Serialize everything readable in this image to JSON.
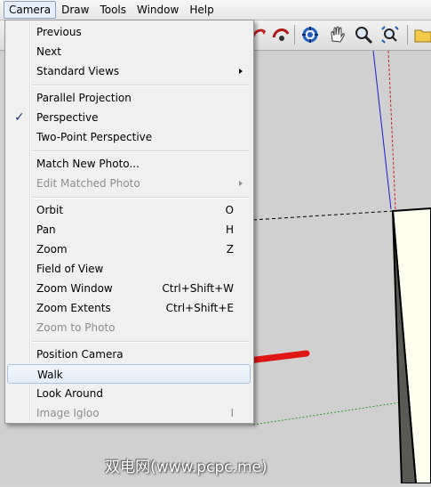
{
  "menubar": {
    "items": [
      {
        "label": "Camera"
      },
      {
        "label": "Draw"
      },
      {
        "label": "Tools"
      },
      {
        "label": "Window"
      },
      {
        "label": "Help"
      }
    ]
  },
  "toolbar": {
    "tools": [
      "tape-icon",
      "look-around-icon",
      "orbit-icon",
      "pan-icon",
      "zoom-icon",
      "zoom-extents-icon",
      "folder-icon"
    ]
  },
  "camera_menu": {
    "items": [
      {
        "label": "Previous",
        "shortcut": "",
        "enabled": true
      },
      {
        "label": "Next",
        "shortcut": "",
        "enabled": true
      },
      {
        "label": "Standard Views",
        "shortcut": "",
        "enabled": true,
        "submenu": true
      },
      {
        "label": "Parallel Projection",
        "shortcut": "",
        "enabled": true
      },
      {
        "label": "Perspective",
        "shortcut": "",
        "enabled": true,
        "checked": true
      },
      {
        "label": "Two-Point Perspective",
        "shortcut": "",
        "enabled": true
      },
      {
        "label": "Match New Photo...",
        "shortcut": "",
        "enabled": true
      },
      {
        "label": "Edit Matched Photo",
        "shortcut": "",
        "enabled": false,
        "submenu": true
      },
      {
        "label": "Orbit",
        "shortcut": "O",
        "enabled": true
      },
      {
        "label": "Pan",
        "shortcut": "H",
        "enabled": true
      },
      {
        "label": "Zoom",
        "shortcut": "Z",
        "enabled": true
      },
      {
        "label": "Field of View",
        "shortcut": "",
        "enabled": true
      },
      {
        "label": "Zoom Window",
        "shortcut": "Ctrl+Shift+W",
        "enabled": true
      },
      {
        "label": "Zoom Extents",
        "shortcut": "Ctrl+Shift+E",
        "enabled": true
      },
      {
        "label": "Zoom to Photo",
        "shortcut": "",
        "enabled": false
      },
      {
        "label": "Position Camera",
        "shortcut": "",
        "enabled": true
      },
      {
        "label": "Walk",
        "shortcut": "",
        "enabled": true,
        "highlighted": true
      },
      {
        "label": "Look Around",
        "shortcut": "",
        "enabled": true
      },
      {
        "label": "Image Igloo",
        "shortcut": "I",
        "enabled": false
      }
    ],
    "check_glyph": "✓"
  },
  "watermark": "双电网(www.pcpc.me)",
  "colors": {
    "annotation_arrow": "#e01515",
    "model_face": "#fffff0",
    "model_side": "#5a5a55",
    "axis_blue": "#1a1acc",
    "axis_red": "#cc2020",
    "axis_green": "#2a9a2a"
  }
}
